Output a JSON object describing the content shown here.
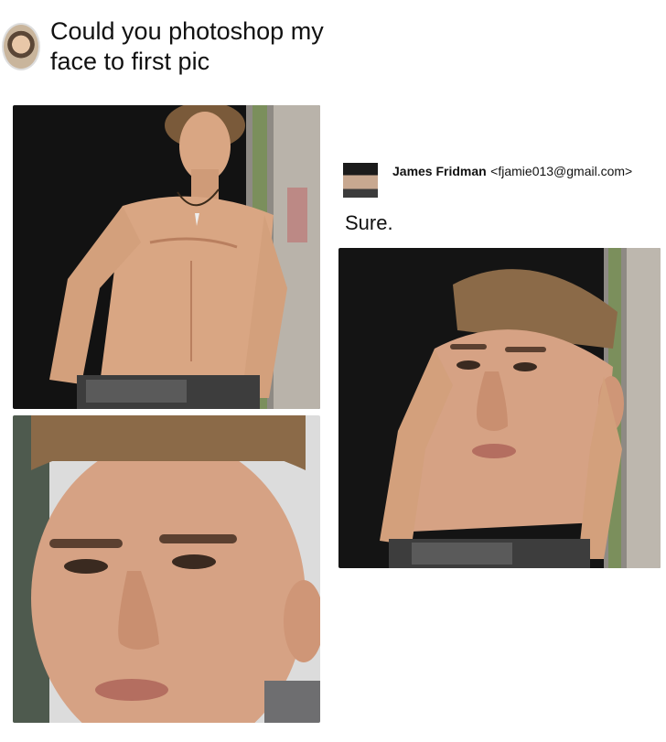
{
  "post": {
    "question_line1": "Could you photoshop my",
    "question_line2": "face to first pic"
  },
  "reply": {
    "sender_name": "James Fridman",
    "sender_email": "<fjamie013@gmail.com>",
    "message": "Sure."
  },
  "colors": {
    "background": "#ffffff",
    "skin": "#d9a683",
    "dark_bg": "#141414",
    "wall_green": "#7b8f5c"
  }
}
